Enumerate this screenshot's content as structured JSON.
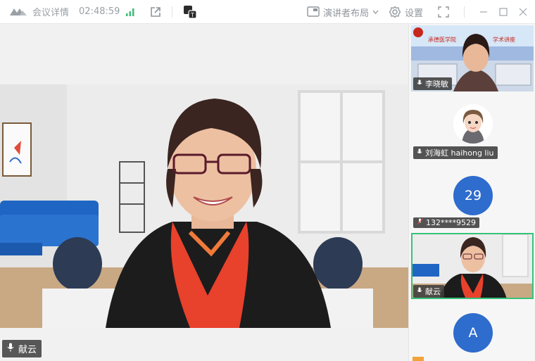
{
  "titlebar": {
    "title": "会议详情",
    "time": "02:48:59",
    "layout_label": "演讲者布局",
    "settings_label": "设置"
  },
  "main": {
    "speaker_name": "献云"
  },
  "participants": [
    {
      "label": "李晓敏",
      "banner_left": "承德医学院",
      "banner_right": "学术讲座"
    },
    {
      "label": "刘海虹 haihong liu"
    },
    {
      "label": "132****9529",
      "badge": "29"
    },
    {
      "label": "献云"
    },
    {
      "label": "",
      "badge": "A"
    }
  ],
  "colors": {
    "accent_blue": "#2e6ccd",
    "active_green": "#37c27a",
    "signal_green": "#3ebd73"
  }
}
